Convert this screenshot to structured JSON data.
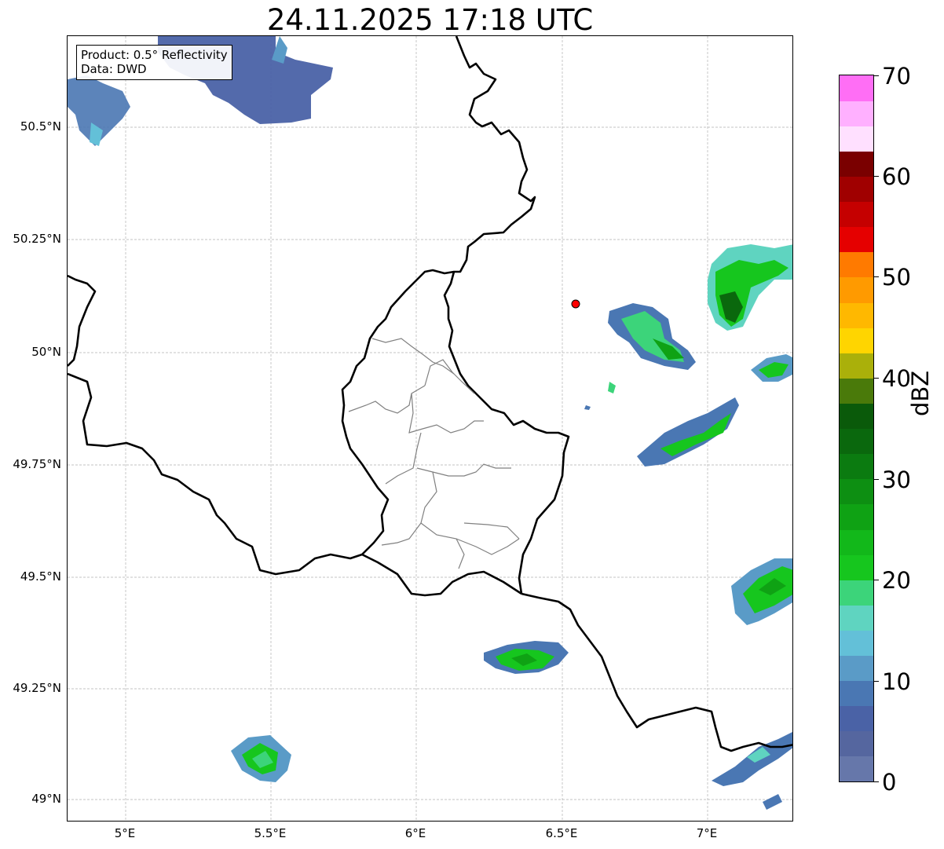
{
  "title": "24.11.2025 17:18 UTC",
  "info_box": {
    "product": "Product: 0.5° Reflectivity",
    "data_source": "Data: DWD"
  },
  "latitude_labels": [
    "50.5°N",
    "50.25°N",
    "50°N",
    "49.75°N",
    "49.5°N",
    "49.25°N",
    "49°N"
  ],
  "longitude_labels": [
    "5°E",
    "5.5°E",
    "6°E",
    "6.5°E",
    "7°E"
  ],
  "map_extent": {
    "lon": [
      4.8,
      7.3
    ],
    "lat": [
      48.95,
      50.7
    ]
  },
  "radar_site_marker_color": "#ff0000",
  "colorbar": {
    "unit": "dBZ",
    "ticks": [
      "0",
      "10",
      "20",
      "30",
      "40",
      "50",
      "60",
      "70"
    ],
    "range": [
      0,
      70
    ],
    "steps": [
      {
        "from": 0,
        "color": "#6677aa"
      },
      {
        "from": 2.5,
        "color": "#55669f"
      },
      {
        "from": 5,
        "color": "#4a62a6"
      },
      {
        "from": 7.5,
        "color": "#4a77b3"
      },
      {
        "from": 10,
        "color": "#5a9bc7"
      },
      {
        "from": 12.5,
        "color": "#63c0d8"
      },
      {
        "from": 15,
        "color": "#5fd4c0"
      },
      {
        "from": 17.5,
        "color": "#3cd47a"
      },
      {
        "from": 20,
        "color": "#16c61e"
      },
      {
        "from": 22.5,
        "color": "#12b81a"
      },
      {
        "from": 25,
        "color": "#0fa214"
      },
      {
        "from": 27.5,
        "color": "#0d8f12"
      },
      {
        "from": 30,
        "color": "#0b7b10"
      },
      {
        "from": 32.5,
        "color": "#0a680d"
      },
      {
        "from": 35,
        "color": "#0a5a0a"
      },
      {
        "from": 37.5,
        "color": "#4a7a0a"
      },
      {
        "from": 40,
        "color": "#aab00a"
      },
      {
        "from": 42.5,
        "color": "#ffd500"
      },
      {
        "from": 45,
        "color": "#ffb800"
      },
      {
        "from": 47.5,
        "color": "#ff9a00"
      },
      {
        "from": 50,
        "color": "#ff7a00"
      },
      {
        "from": 52.5,
        "color": "#e50000"
      },
      {
        "from": 55,
        "color": "#c50000"
      },
      {
        "from": 57.5,
        "color": "#a00000"
      },
      {
        "from": 60,
        "color": "#7a0000"
      },
      {
        "from": 62.5,
        "color": "#ffe0ff"
      },
      {
        "from": 65,
        "color": "#ffb0ff"
      },
      {
        "from": 67.5,
        "color": "#ff6ef5"
      },
      {
        "from": 70,
        "color": "#ea3ee8"
      }
    ]
  },
  "colors": {
    "border": "#000000",
    "admin_border": "#808080",
    "grid": "#b0b0b0"
  }
}
